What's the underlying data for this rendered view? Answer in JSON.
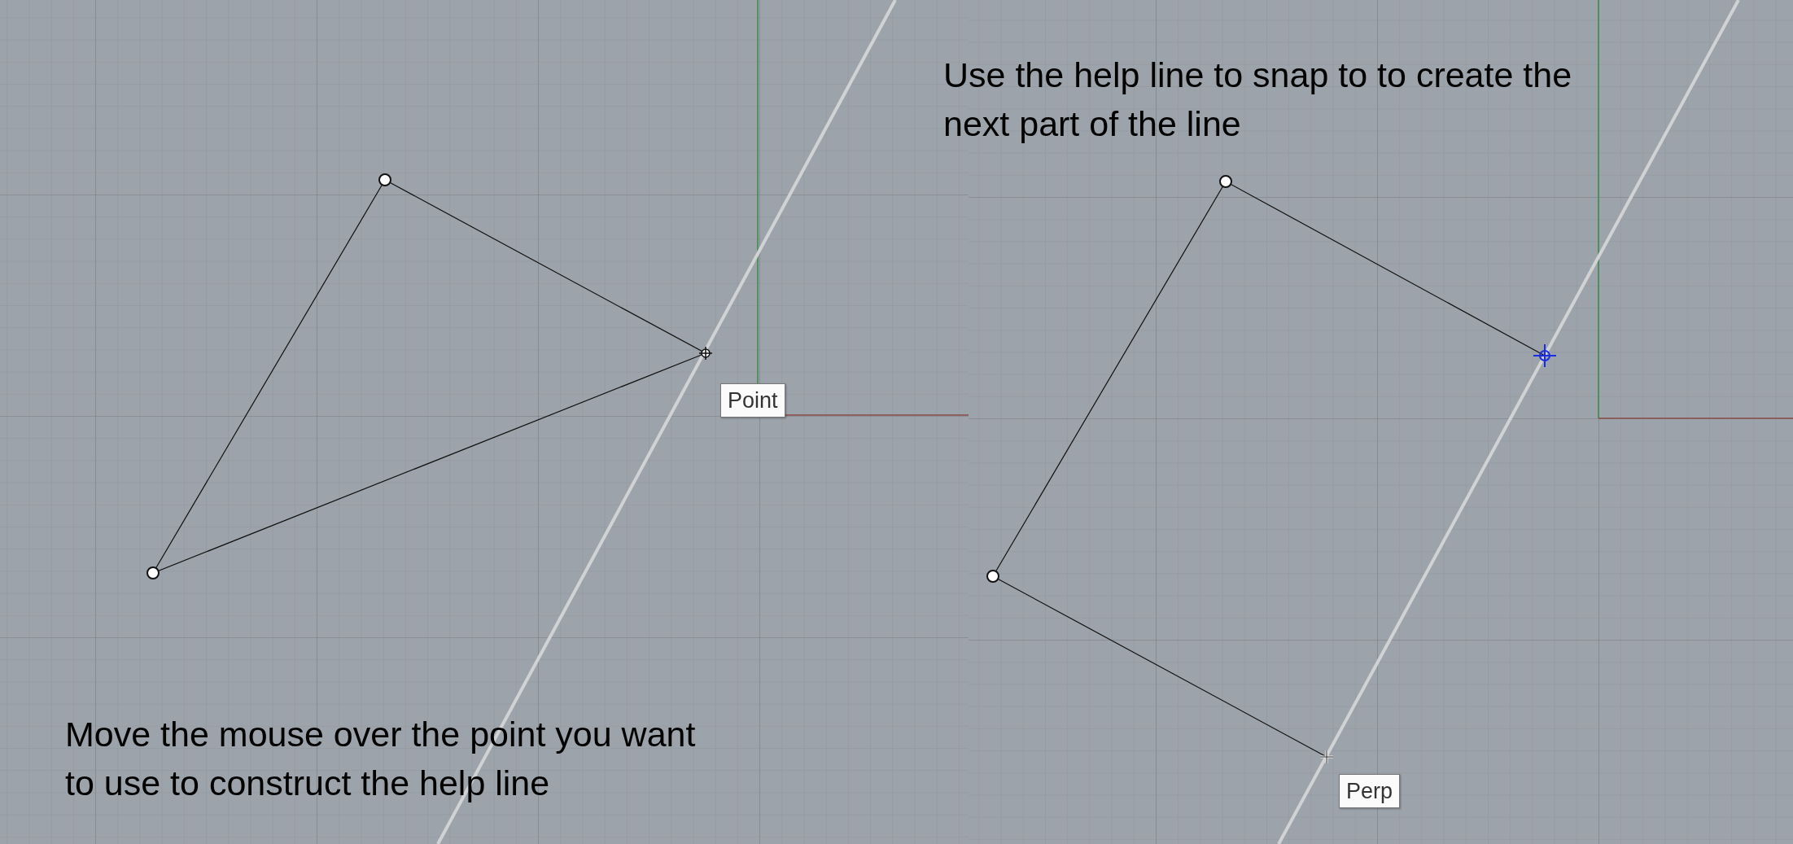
{
  "panels": [
    {
      "caption": [
        "Move the mouse over the point you want",
        "to use to construct the help line"
      ],
      "tooltip": "Point"
    },
    {
      "caption": [
        "Use the help line to snap to to create the",
        "next part of the line"
      ],
      "tooltip": "Perp"
    }
  ]
}
